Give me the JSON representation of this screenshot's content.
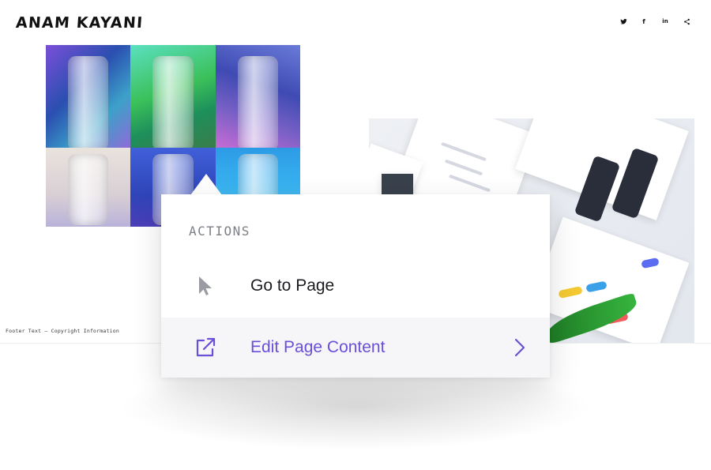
{
  "header": {
    "logo_text": "ANAM KAYANI",
    "social_icons": [
      "twitter-icon",
      "facebook-icon",
      "linkedin-icon",
      "share-icon"
    ],
    "social_labels": {
      "facebook": "f",
      "linkedin": "in"
    }
  },
  "footer": {
    "text": "Footer Text — Copyright Information"
  },
  "popover": {
    "section_label": "ACTIONS",
    "items": [
      {
        "label": "Go to Page",
        "icon": "cursor-pointer-icon",
        "color": "#1b1c21"
      },
      {
        "label": "Edit Page Content",
        "icon": "external-link-icon",
        "color": "#6b4fd8",
        "trailing_icon": "chevron-right-icon"
      }
    ]
  },
  "colors": {
    "accent": "#6b4fd8",
    "label_gray": "#7d7f86",
    "highlight_row_bg": "#f6f6f8"
  }
}
